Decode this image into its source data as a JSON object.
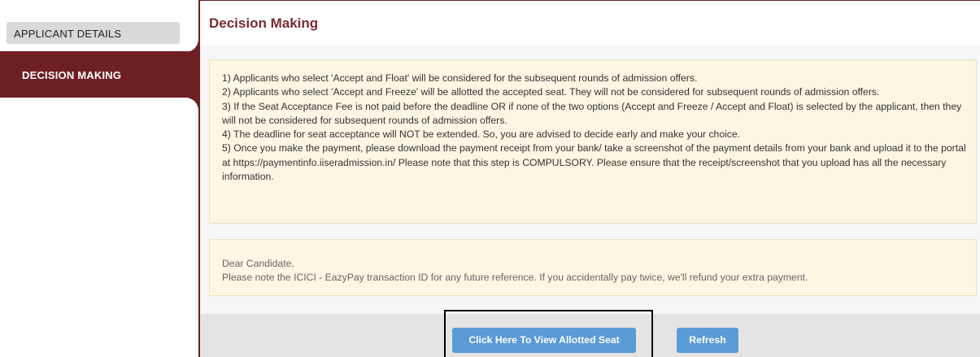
{
  "sidebar": {
    "items": [
      {
        "label": "APPLICANT DETAILS"
      },
      {
        "label": "DECISION MAKING"
      }
    ]
  },
  "main": {
    "title": "Decision Making",
    "notice": {
      "lines": [
        "1) Applicants who select 'Accept and Float' will be considered for the subsequent rounds of admission offers.",
        "2) Applicants who select 'Accept and Freeze' will be allotted the accepted seat. They will not be considered for subsequent rounds of admission offers.",
        "3) If the Seat Acceptance Fee is not paid before the deadline OR if none of the two options (Accept and Freeze / Accept and Float) is selected by the applicant, then they will not be considered for subsequent rounds of admission offers.",
        "4) The deadline for seat acceptance will NOT be extended. So, you are advised to decide early and make your choice.",
        "5) Once you make the payment, please download the payment receipt from your bank/ take a screenshot of the payment details from your bank and upload it to the portal at https://paymentinfo.iiseradmission.in/ Please note that this step is COMPULSORY. Please ensure that the receipt/screenshot that you upload has all the necessary information."
      ]
    },
    "note": {
      "greeting": "Dear Candidate,",
      "text": "Please note the ICICI - EazyPay transaction ID for any future reference. If you accidentally pay twice, we'll refund your extra payment."
    },
    "buttons": {
      "view_label": "Click Here To View Allotted Seat",
      "refresh_label": "Refresh"
    }
  },
  "colors": {
    "brand": "#6e1f24",
    "title": "#7a2b2f",
    "notice_bg": "#fdf6e3",
    "button": "#5b9bd5"
  }
}
